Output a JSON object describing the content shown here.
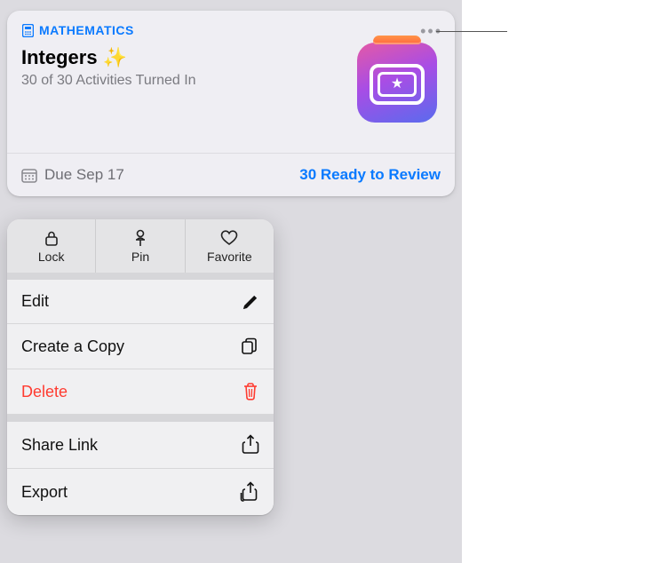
{
  "card": {
    "subject": "MATHEMATICS",
    "title": "Integers",
    "sparkles": "✨",
    "turned_in": "30 of 30 Activities Turned In",
    "due_label": "Due Sep 17",
    "ready_label": "30 Ready to Review"
  },
  "menu": {
    "top": [
      {
        "label": "Lock"
      },
      {
        "label": "Pin"
      },
      {
        "label": "Favorite"
      }
    ],
    "edit": "Edit",
    "copy": "Create a Copy",
    "delete": "Delete",
    "share": "Share Link",
    "export": "Export"
  }
}
